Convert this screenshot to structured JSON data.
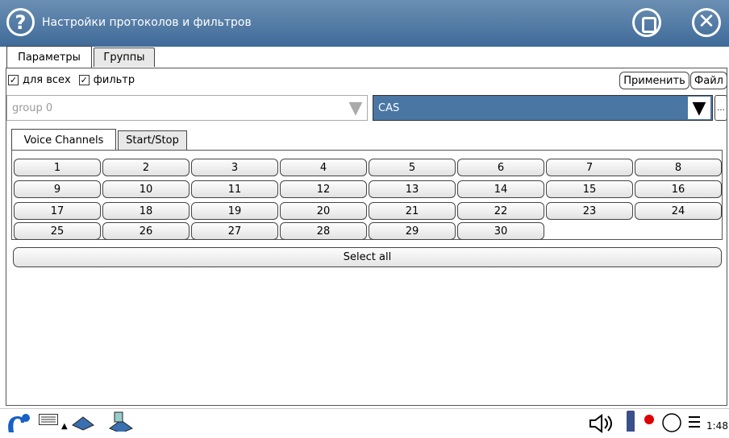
{
  "window": {
    "title": "Настройки протоколов и фильтров",
    "help_symbol": "?",
    "close_symbol": "✕"
  },
  "tabs_top": [
    {
      "label": "Параметры",
      "active": true
    },
    {
      "label": "Группы",
      "active": false
    }
  ],
  "options": {
    "for_all_label": "для всех",
    "for_all_checked": true,
    "filter_label": "фильтр",
    "filter_checked": true
  },
  "buttons": {
    "apply": "Применить",
    "file": "Файл",
    "more": "..."
  },
  "group_select": {
    "value": "group 0",
    "disabled": true
  },
  "protocol_select": {
    "value": "CAS"
  },
  "tabs_inner": [
    {
      "label": "Voice Channels",
      "active": true
    },
    {
      "label": "Start/Stop",
      "active": false
    }
  ],
  "channels": [
    "1",
    "2",
    "3",
    "4",
    "5",
    "6",
    "7",
    "8",
    "9",
    "10",
    "11",
    "12",
    "13",
    "14",
    "15",
    "16",
    "17",
    "18",
    "19",
    "20",
    "21",
    "22",
    "23",
    "24",
    "25",
    "26",
    "27",
    "28",
    "29",
    "30"
  ],
  "select_all": "Select all",
  "taskbar": {
    "clock": "1:48",
    "icons": [
      "app-logo-icon",
      "keyboard-icon",
      "arrow-up-icon",
      "network-icon",
      "modem-icon",
      "speaker-icon",
      "battery-icon",
      "record-icon",
      "circle-icon",
      "menu-icon"
    ]
  },
  "colors": {
    "titlebar": "#4a76a4",
    "selected_combo": "#4a76a4",
    "record": "#e00000"
  }
}
